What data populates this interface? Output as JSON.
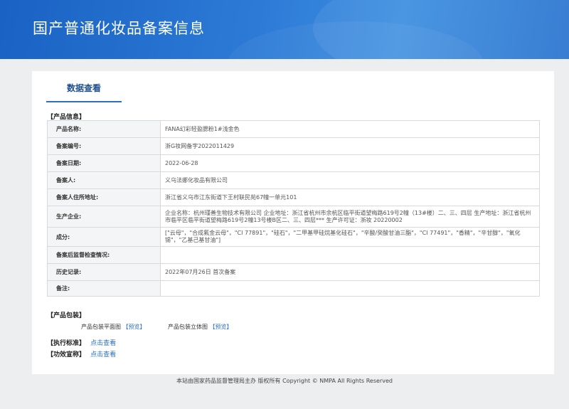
{
  "header": {
    "title": "国产普通化妆品备案信息"
  },
  "tab": {
    "label": "数据查看"
  },
  "sections": {
    "product_info": "【产品信息】",
    "product_package": "【产品包装】",
    "standard": "【执行标准】",
    "efficacy": "【功效宣称】"
  },
  "rows": [
    {
      "key": "产品名称:",
      "value": "FANA幻彩轻盈腮粉1#浅金色"
    },
    {
      "key": "备案编号:",
      "value": "浙G妆网备字2022011429"
    },
    {
      "key": "备案日期:",
      "value": "2022-06-28"
    },
    {
      "key": "备案人:",
      "value": "义乌法娜化妆品有限公司"
    },
    {
      "key": "备案人住所地址:",
      "value": "浙江省义乌市江东街道下王村联民苑67幢一单元101"
    },
    {
      "key": "生产企业:",
      "value": "企业名称：杭州瑾善生物技术有限公司 企业地址：浙江省杭州市余杭区临平街道望梅路619号2幢（13#楼）二、三、四层 生产地址：浙江省杭州市临平区临平街道望梅路619号2幢13号楼B区二、三、四层*** 生产许可证：浙妆 20220002"
    },
    {
      "key": "成分:",
      "value": "[\"云母\"，\"合成氟金云母\"，\"CI 77891\"，\"硅石\"，\"二甲基甲硅烷基化硅石\"，\"辛酸/癸酸甘油三酯\"，\"CI 77491\"，\"香精\"，\"辛甘醇\"，\"氧化锡\"，\"乙基己基甘油\"]"
    },
    {
      "key": "备案后监督检查情况:",
      "value": ""
    },
    {
      "key": "历史记录:",
      "value": "2022年07月26日 首次备案"
    },
    {
      "key": "备注:",
      "value": ""
    }
  ],
  "package": {
    "flat_label": "产品包装平面图",
    "flat_link": "【预览】",
    "solid_label": "产品包装立体图",
    "solid_link": "【预览】"
  },
  "standard_link": "点击查看",
  "efficacy_link": "点击查看",
  "footer": "本站由国家药品监督管理局主办 版权所有 Copyright © NMPA All Rights Reserved",
  "colors": {
    "banner": "#2c7ad6",
    "accent": "#2e6fc0",
    "link": "#2a6fc8"
  }
}
